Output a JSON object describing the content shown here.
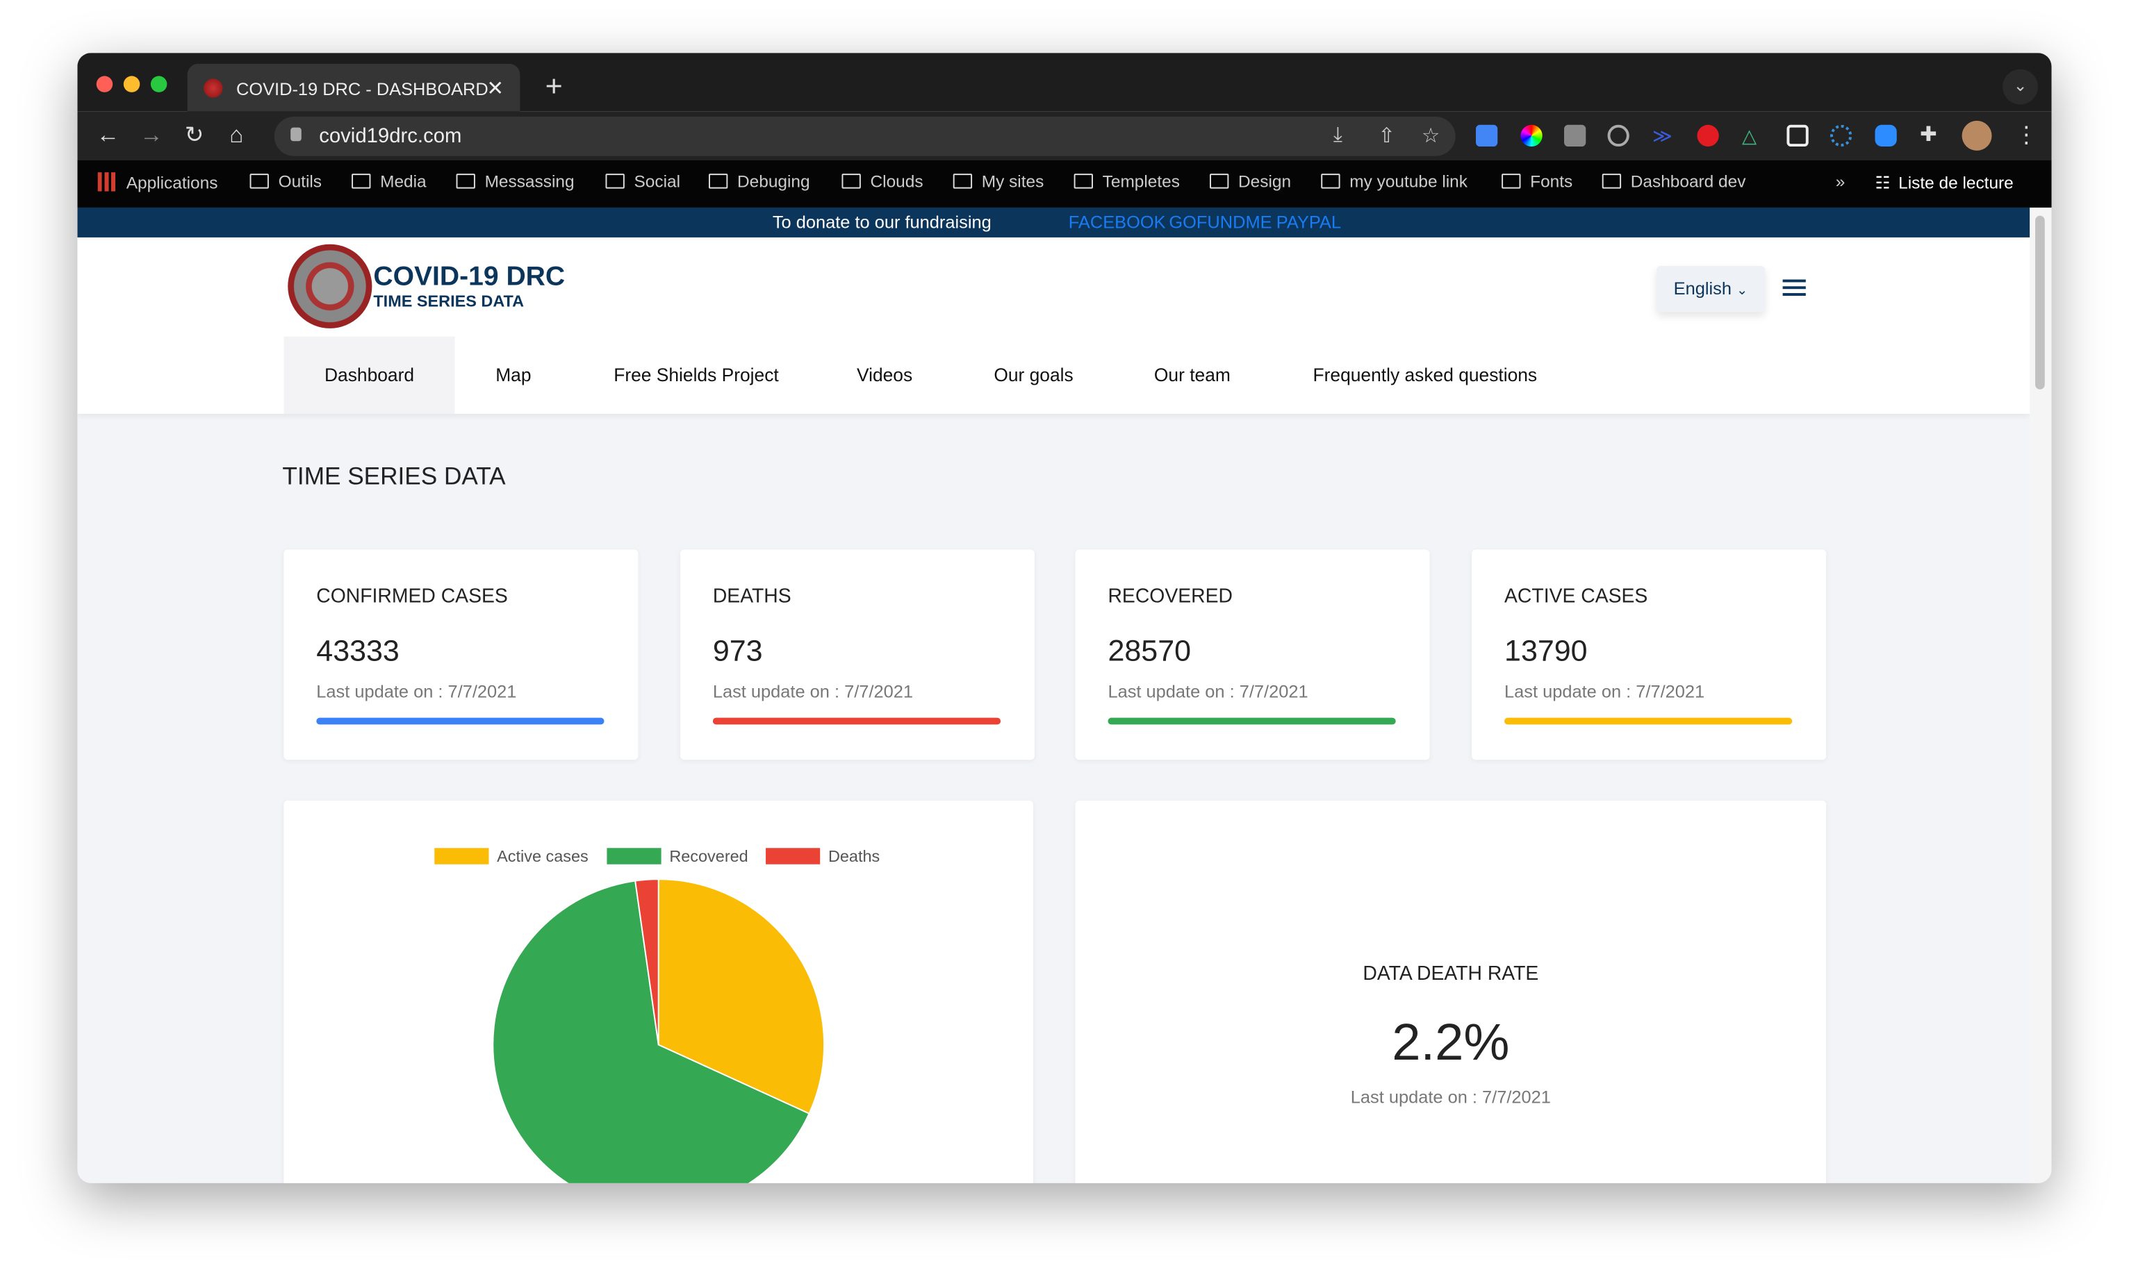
{
  "browser": {
    "tab_title": "COVID-19 DRC - DASHBOARD",
    "url": "covid19drc.com",
    "bookmarks": [
      "Applications",
      "Outils",
      "Media",
      "Messassing",
      "Social",
      "Debuging",
      "Clouds",
      "My sites",
      "Templetes",
      "Design",
      "my youtube link",
      "Fonts",
      "Dashboard dev"
    ],
    "overflow": "»",
    "reading_list": "Liste de lecture"
  },
  "banner": {
    "text": "To donate to our fundraising",
    "links": [
      "FACEBOOK",
      "GOFUNDME",
      "PAYPAL"
    ]
  },
  "header": {
    "logo_title": "COVID-19 DRC",
    "logo_subtitle": "TIME SERIES DATA",
    "language": "English"
  },
  "nav": [
    "Dashboard",
    "Map",
    "Free Shields Project",
    "Videos",
    "Our goals",
    "Our team",
    "Frequently asked questions"
  ],
  "page_title": "TIME SERIES DATA",
  "cards": [
    {
      "title": "CONFIRMED CASES",
      "value": "43333",
      "update": "Last update on : 7/7/2021",
      "color": "#3b82f6"
    },
    {
      "title": "DEATHS",
      "value": "973",
      "update": "Last update on : 7/7/2021",
      "color": "#ea4335"
    },
    {
      "title": "RECOVERED",
      "value": "28570",
      "update": "Last update on : 7/7/2021",
      "color": "#34a853"
    },
    {
      "title": "ACTIVE CASES",
      "value": "13790",
      "update": "Last update on : 7/7/2021",
      "color": "#fbbc05"
    }
  ],
  "chart_data": {
    "type": "pie",
    "categories": [
      "Active cases",
      "Recovered",
      "Deaths"
    ],
    "values": [
      13790,
      28570,
      973
    ],
    "colors": [
      "#fbbc05",
      "#34a853",
      "#ea4335"
    ],
    "legend": "top"
  },
  "death_rate": {
    "title": "DATA DEATH RATE",
    "value": "2.2%",
    "update": "Last update on : 7/7/2021"
  }
}
